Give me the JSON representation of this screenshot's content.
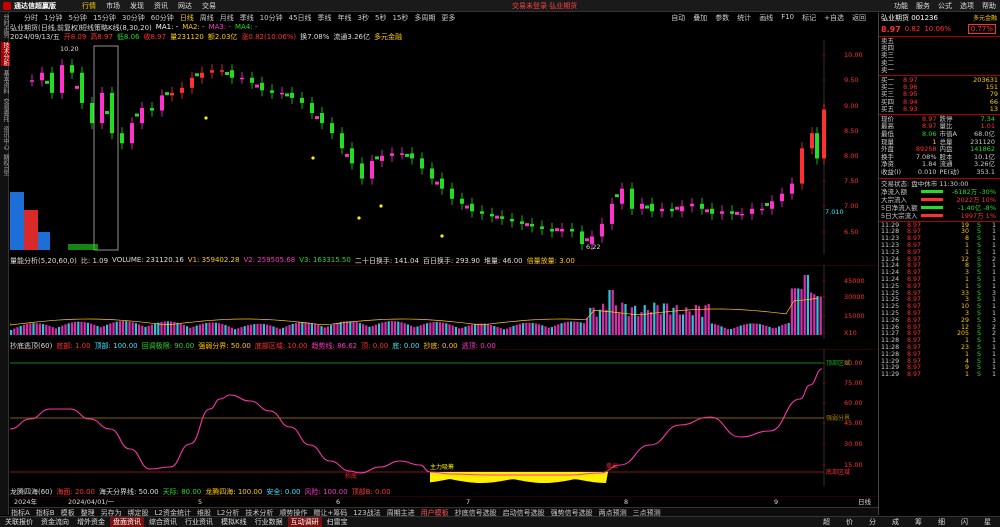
{
  "app": {
    "name": "通达信超赢版",
    "menu": [
      "行情",
      "市场",
      "发现",
      "资讯",
      "网达",
      "交易"
    ],
    "menu_active": 0,
    "login_text": "交易未登录  弘业期货",
    "right_menu": [
      "功能",
      "服务",
      "公式",
      "选项",
      "帮助"
    ]
  },
  "left_tabs": [
    "分时走势",
    "技术分析",
    "基本资料",
    "交易委托",
    "资讯中心",
    "期权T型"
  ],
  "left_active": 1,
  "periods": [
    "分时",
    "1分钟",
    "5分钟",
    "15分钟",
    "30分钟",
    "60分钟",
    "日线",
    "周线",
    "月线",
    "季线",
    "10分钟",
    "45日线",
    "季线",
    "年线",
    "3秒",
    "5秒",
    "15秒",
    "多周期",
    "更多"
  ],
  "period_active": 6,
  "tools": [
    "自动",
    "叠加",
    "参数",
    "统计",
    "画线",
    "F10",
    "标记",
    "+自选",
    "返回"
  ],
  "main_info": {
    "title": "弘业期货(日线,前复权)",
    "date": "2024/09/13/五",
    "o": "开8.09",
    "h": "高8.97",
    "l": "低8.06",
    "c": "收8.97",
    "v": "量231120",
    "amt": "额2.03亿",
    "chg": "涨0.82(10.06%)",
    "turn": "换7.08%",
    "cap": "流通3.26亿",
    "tag": "多元金融",
    "ind": "短线策略K线(8,30,20)",
    "ma1": "MA1: -",
    "ma2": "MA2: -",
    "ma3": "MA3: -",
    "ma4": "MA4: -",
    "high_mark": "10.20",
    "low_mark": "6.22",
    "last_mark": "7.010"
  },
  "yaxis_main": [
    "10.00",
    "9.50",
    "9.00",
    "8.50",
    "8.00",
    "7.50",
    "7.00",
    "6.50"
  ],
  "yaxis_vol": [
    "45000",
    "30000",
    "15000",
    "X10"
  ],
  "yaxis_osc": [
    "90.00",
    "75.00",
    "60.00",
    "45.00",
    "30.00",
    "15.00"
  ],
  "vol_info": {
    "name": "量能分析(5,20,60,0)",
    "ratio": "比: 1.09",
    "volume": "VOLUME: 231120.16",
    "v1": "V1: 359402.28",
    "v2": "V2: 259505.68",
    "v3": "V3: 163315.50",
    "e1": "二十日换手: 141.04",
    "e2": "百日换手: 293.90",
    "e3": "堆量: 46.00",
    "e4": "倍量放量: 3.00"
  },
  "osc_info": {
    "name": "抄底逃顶(60)",
    "a": "底部: 1.00",
    "b": "顶部: 100.00",
    "c": "回调极限: 90.00",
    "d": "强弱分界: 50.00",
    "e": "底部区域: 10.00",
    "f": "趋势线: 86.62",
    "g": "顶: 0.00",
    "h": "底: 0.00",
    "i": "抄底: 0.00",
    "j": "逃顶: 0.00",
    "top_zone": "顶部区域",
    "mid_zone": "强弱分界",
    "bot_zone": "底部区域",
    "buy": "抄底",
    "sell": "卖出",
    "main_label": "主力吸筹"
  },
  "dragon_info": {
    "name": "龙腾四海(60)",
    "a": "海面: 20.00",
    "b": "海天分界线: 50.00",
    "c": "天际: 80.00",
    "d": "龙腾四海: 100.00",
    "e": "安全: 0.00",
    "f": "风险: 100.00",
    "g": "顶部B: 0.00"
  },
  "xaxis": [
    "2024年",
    "2024/04/01/一",
    "5",
    "6",
    "7",
    "8",
    "9",
    "日线"
  ],
  "bottom_tabs": [
    "指标A",
    "指标B",
    "模板",
    "整理",
    "另存为",
    "绑定股",
    "L2资金统计",
    "维股",
    "L2分析",
    "技术分析",
    "顺势操作",
    "赠让+筹码",
    "123战法",
    "周期主进",
    "用户模板",
    "抄底信号选股",
    "启动信号选股",
    "强势信号选股",
    "两点预测",
    "三点预测"
  ],
  "bottom_active": 14,
  "status": {
    "items": [
      "关联报价",
      "资金流向",
      "增外资金",
      "盘面资讯",
      "综合资讯",
      "行业资讯",
      "模拟K线",
      "行业数据",
      "互动调研",
      "扫雷宝"
    ],
    "highlight": [
      3,
      8
    ],
    "right": [
      "超",
      "价",
      "分",
      "成",
      "筹",
      "细",
      "闪",
      "星"
    ]
  },
  "quote": {
    "title": "弘业期货 001236",
    "market": "多元金融",
    "price": "8.97",
    "change": "0.82",
    "pct": "10.06%",
    "box": "0.77%",
    "ask": [
      {
        "l": "卖五",
        "p": "",
        "v": ""
      },
      {
        "l": "卖四",
        "p": "",
        "v": ""
      },
      {
        "l": "卖三",
        "p": "",
        "v": ""
      },
      {
        "l": "卖二",
        "p": "",
        "v": ""
      },
      {
        "l": "卖一",
        "p": "",
        "v": ""
      }
    ],
    "bid": [
      {
        "l": "买一",
        "p": "8.97",
        "v": "203631"
      },
      {
        "l": "买二",
        "p": "8.96",
        "v": "151"
      },
      {
        "l": "买三",
        "p": "8.95",
        "v": "79"
      },
      {
        "l": "买四",
        "p": "8.94",
        "v": "66"
      },
      {
        "l": "买五",
        "p": "8.93",
        "v": "13"
      }
    ],
    "stats": [
      [
        "现价",
        "8.97",
        "r",
        "跌停",
        "7.34",
        "g"
      ],
      [
        "最高",
        "8.97",
        "r",
        "量比",
        "1.01",
        "r"
      ],
      [
        "最低",
        "8.06",
        "g",
        "市值A",
        "68.0亿",
        "k"
      ],
      [
        "现量",
        "1",
        "y",
        "总量",
        "231120",
        "k"
      ],
      [
        "外盘",
        "89258",
        "r",
        "内盘",
        "141862",
        "g"
      ],
      [
        "换手",
        "7.08%",
        "k",
        "股本",
        "10.1亿",
        "k"
      ],
      [
        "净资",
        "1.84",
        "k",
        "流通",
        "3.26亿",
        "k"
      ],
      [
        "收益(I)",
        "0.010",
        "k",
        "PE(动)",
        "353.1",
        "k"
      ]
    ],
    "status": "交易状态: 盘中休市 11:30:00",
    "flows": [
      {
        "k": "净流入额",
        "n": "-6182万 -30%",
        "color": "#22dd22"
      },
      {
        "k": "大宗流入",
        "n": "2022万 10%",
        "color": "#ff3030"
      },
      {
        "k": "5日净流入额",
        "n": "-1.40亿 -8%",
        "color": "#22dd22"
      },
      {
        "k": "5日大宗流入",
        "n": "1997万 1%",
        "color": "#ff3030"
      }
    ],
    "ticks": [
      [
        "11:29",
        "8.97",
        "19",
        "S",
        "1"
      ],
      [
        "11:28",
        "8.97",
        "30",
        "S",
        "1"
      ],
      [
        "11:23",
        "8.97",
        "8",
        "S",
        "1"
      ],
      [
        "11:23",
        "8.97",
        "1",
        "S",
        "1"
      ],
      [
        "11:23",
        "8.97",
        "1",
        "S",
        "1"
      ],
      [
        "11:24",
        "8.97",
        "12",
        "S",
        "2"
      ],
      [
        "11:24",
        "8.97",
        "8",
        "S",
        "1"
      ],
      [
        "11:24",
        "8.97",
        "3",
        "S",
        "1"
      ],
      [
        "11:24",
        "8.97",
        "1",
        "S",
        "1"
      ],
      [
        "11:25",
        "8.97",
        "1",
        "S",
        "1"
      ],
      [
        "11:25",
        "8.97",
        "33",
        "S",
        "3"
      ],
      [
        "11:25",
        "8.97",
        "3",
        "S",
        "1"
      ],
      [
        "11:25",
        "8.97",
        "10",
        "S",
        "1"
      ],
      [
        "11:25",
        "8.97",
        "3",
        "S",
        "1"
      ],
      [
        "11:26",
        "8.97",
        "29",
        "S",
        "3"
      ],
      [
        "11:26",
        "8.97",
        "12",
        "S",
        "2"
      ],
      [
        "11:27",
        "8.97",
        "205",
        "S",
        "2"
      ],
      [
        "11:28",
        "8.97",
        "1",
        "S",
        "1"
      ],
      [
        "11:28",
        "8.97",
        "23",
        "S",
        "1"
      ],
      [
        "11:28",
        "8.97",
        "1",
        "S",
        "1"
      ],
      [
        "11:29",
        "8.97",
        "4",
        "S",
        "1"
      ],
      [
        "11:29",
        "8.97",
        "9",
        "S",
        "1"
      ],
      [
        "11:29",
        "8.97",
        "1",
        "S",
        "1"
      ]
    ]
  },
  "colors": {
    "up": "#ff3030",
    "down": "#22dd22",
    "magenta": "#ff33cc",
    "cyan": "#33e6ff",
    "yellow": "#ffee00"
  }
}
